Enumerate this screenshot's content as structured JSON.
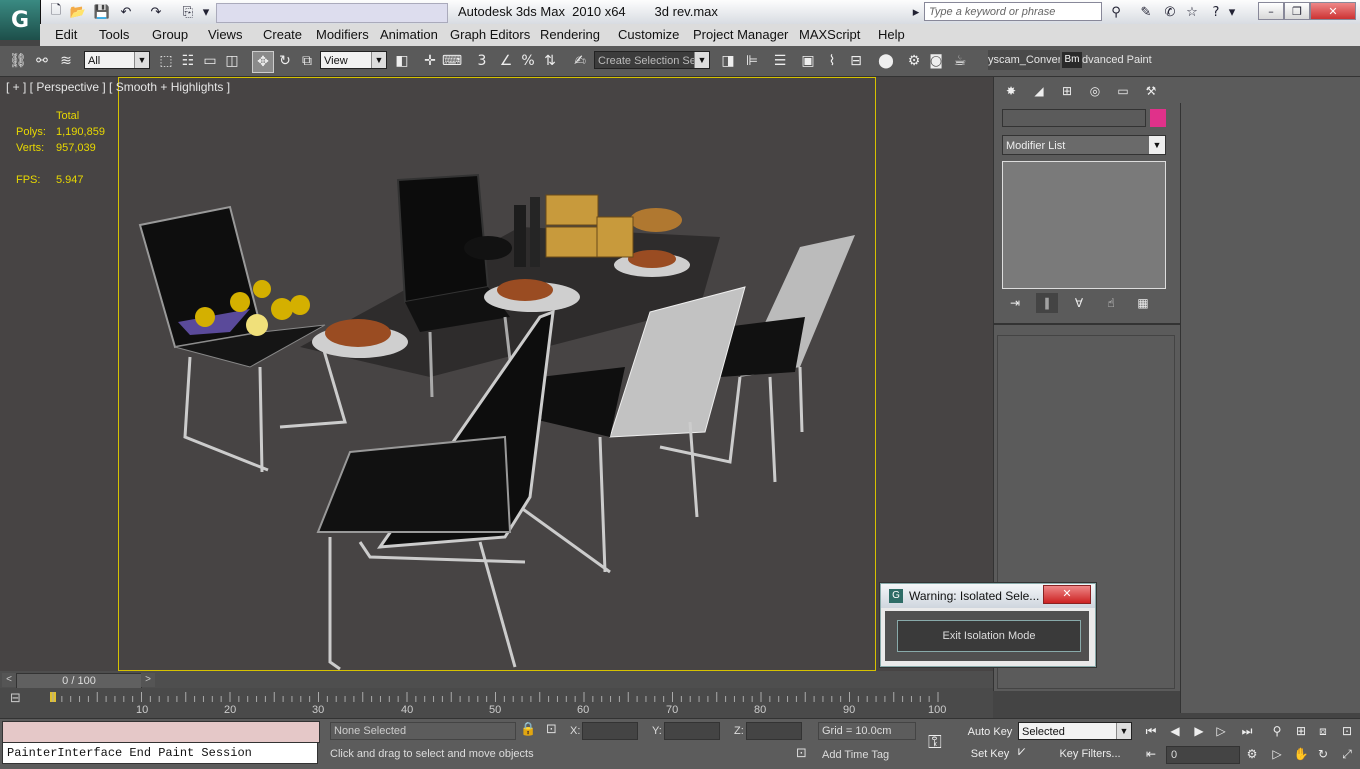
{
  "window": {
    "title": "Autodesk 3ds Max  2010 x64        3d rev.max",
    "search_placeholder": "Type a keyword or phrase"
  },
  "menu": [
    "Edit",
    "Tools",
    "Group",
    "Views",
    "Create",
    "Modifiers",
    "Animation",
    "Graph Editors",
    "Rendering",
    "Customize",
    "Project Manager",
    "MAXScript",
    "Help"
  ],
  "toolbar": {
    "filter_value": "All",
    "ref_coord_value": "View",
    "selection_set_value": "Create Selection Se",
    "script_tab1": "yscam_Conver",
    "script_tab2_icon": "Bm",
    "script_tab3": "dvanced Paint"
  },
  "viewport": {
    "label": "[ + ] [ Perspective ] [ Smooth + Highlights ]",
    "stats_header": "Total",
    "polys_label": "Polys:",
    "polys_value": "1,190,859",
    "verts_label": "Verts:",
    "verts_value": "957,039",
    "fps_label": "FPS:",
    "fps_value": "5.947"
  },
  "command_panel": {
    "modifier_list": "Modifier List",
    "color_swatch": "#e0318a"
  },
  "dialog": {
    "title": "Warning: Isolated Sele...",
    "button": "Exit Isolation Mode"
  },
  "timeline": {
    "slider_label": "0 / 100",
    "ticks": [
      "10",
      "20",
      "30",
      "40",
      "50",
      "60",
      "70",
      "80",
      "90",
      "100"
    ]
  },
  "status": {
    "maxscript_line": "PainterInterface End Paint Session",
    "selection": "None Selected",
    "prompt": "Click and drag to select and move objects",
    "x_label": "X:",
    "y_label": "Y:",
    "z_label": "Z:",
    "grid": "Grid = 10.0cm",
    "add_time_tag": "Add Time Tag",
    "auto_key": "Auto Key",
    "set_key": "Set Key",
    "key_mode_value": "Selected",
    "key_filters": "Key Filters...",
    "frame_value": "0"
  }
}
